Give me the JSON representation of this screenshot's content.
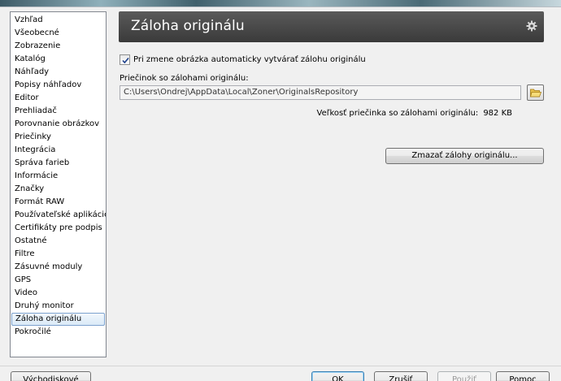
{
  "sidebar": {
    "items": [
      {
        "label": "Vzhľad"
      },
      {
        "label": "Všeobecné"
      },
      {
        "label": "Zobrazenie"
      },
      {
        "label": "Katalóg"
      },
      {
        "label": "Náhľady"
      },
      {
        "label": "Popisy náhľadov"
      },
      {
        "label": "Editor"
      },
      {
        "label": "Prehliadač"
      },
      {
        "label": "Porovnanie obrázkov"
      },
      {
        "label": "Priečinky"
      },
      {
        "label": "Integrácia"
      },
      {
        "label": "Správa farieb"
      },
      {
        "label": "Informácie"
      },
      {
        "label": "Značky"
      },
      {
        "label": "Formát RAW"
      },
      {
        "label": "Používateľské aplikácie"
      },
      {
        "label": "Certifikáty pre podpis"
      },
      {
        "label": "Ostatné"
      },
      {
        "label": "Filtre"
      },
      {
        "label": "Zásuvné moduly"
      },
      {
        "label": "GPS"
      },
      {
        "label": "Video"
      },
      {
        "label": "Druhý monitor"
      },
      {
        "label": "Záloha originálu",
        "selected": true
      },
      {
        "label": "Pokročilé"
      }
    ]
  },
  "header": {
    "title": "Záloha originálu",
    "icon": "gear-icon"
  },
  "settings": {
    "auto_backup_label": "Pri zmene obrázka automaticky vytvárať zálohu originálu",
    "auto_backup_checked": true,
    "folder_label": "Priečinok so zálohami originálu:",
    "folder_path": "C:\\Users\\Ondrej\\AppData\\Local\\Zoner\\OriginalsRepository",
    "browse_icon": "folder-open-icon",
    "size_label": "Veľkosť priečinka so zálohami originálu:",
    "size_value": "982 KB",
    "delete_button": "Zmazať zálohy originálu..."
  },
  "footer": {
    "default_button": "Východiskové",
    "ok_button": "OK",
    "cancel_button": "Zrušiť",
    "apply_button": "Použiť",
    "help_button": "Pomoc"
  },
  "colors": {
    "header_bg": "#4a4a4a",
    "selection_border": "#7da2ce"
  }
}
